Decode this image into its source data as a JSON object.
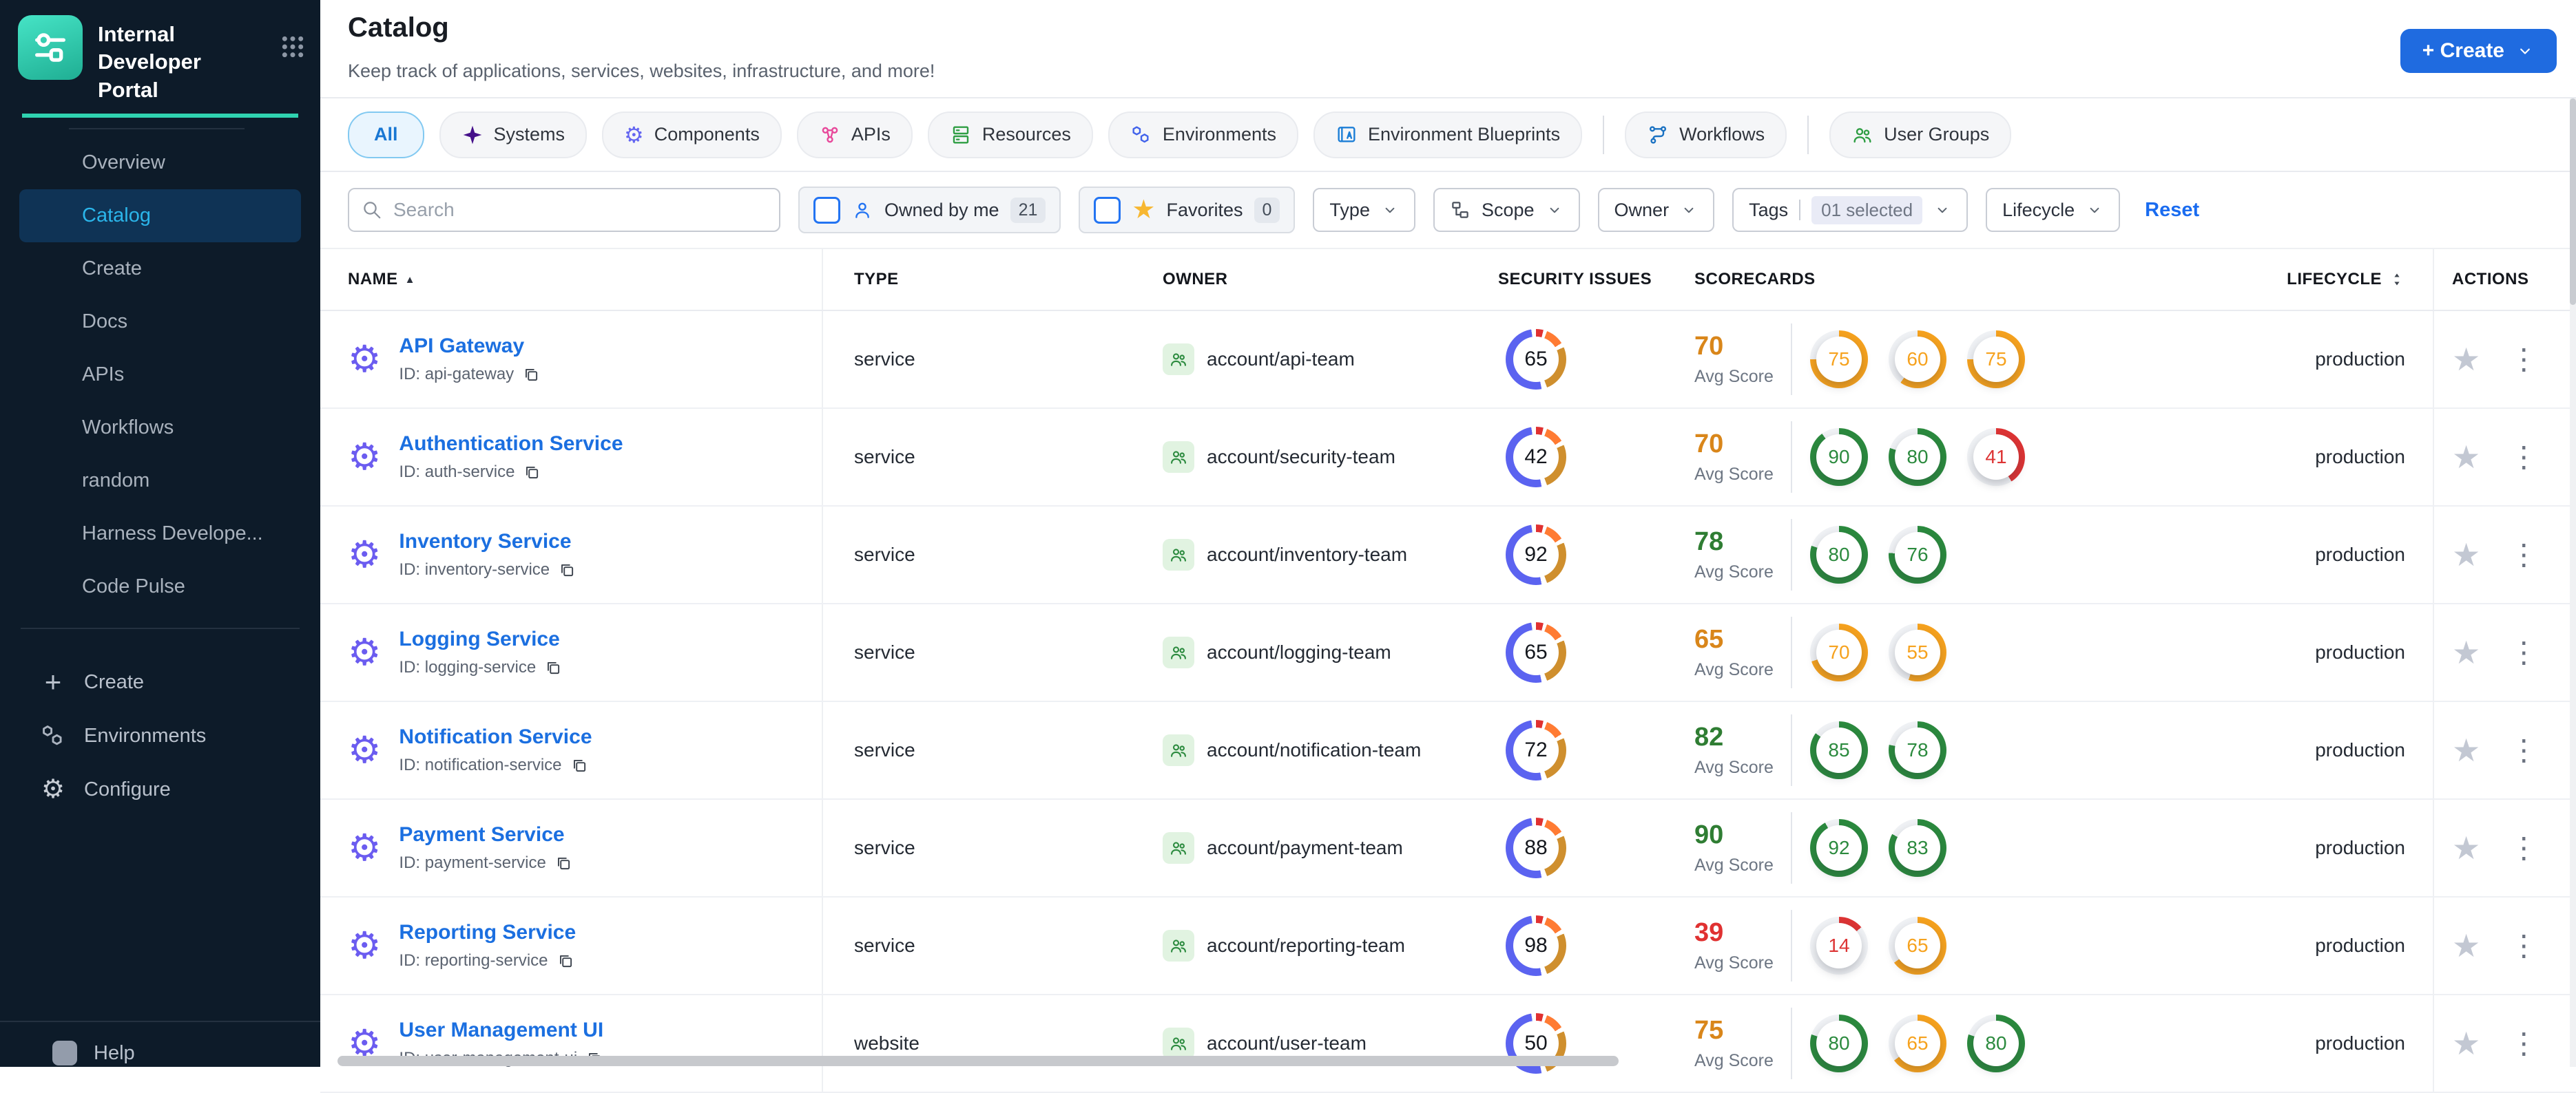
{
  "app": {
    "name": "Internal Developer Portal",
    "create_label": "+ Create",
    "accent_teal": "#2fd3b0",
    "primary_blue": "#1f6be0"
  },
  "icons": {
    "star": "★",
    "kebab": "⋮",
    "gear": "⚙",
    "sort_asc": "▲",
    "plus": "+"
  },
  "sidebar": {
    "items": [
      {
        "label": "Overview",
        "active": false
      },
      {
        "label": "Catalog",
        "active": true
      },
      {
        "label": "Create",
        "active": false
      },
      {
        "label": "Docs",
        "active": false
      },
      {
        "label": "APIs",
        "active": false
      },
      {
        "label": "Workflows",
        "active": false
      },
      {
        "label": "random",
        "active": false
      },
      {
        "label": "Harness Develope...",
        "active": false
      },
      {
        "label": "Code Pulse",
        "active": false
      }
    ],
    "bottom_items": [
      {
        "label": "Create",
        "icon": "plus"
      },
      {
        "label": "Environments",
        "icon": "hexagons"
      },
      {
        "label": "Configure",
        "icon": "gear"
      }
    ],
    "help_label": "Help"
  },
  "header": {
    "title": "Catalog",
    "subtitle": "Keep track of applications, services, websites, infrastructure, and more!"
  },
  "tabs": [
    {
      "label": "All",
      "active": true
    },
    {
      "label": "Systems",
      "icon": "star4",
      "icon_color": "#45108a"
    },
    {
      "label": "Components",
      "icon": "gearglyph",
      "icon_color": "#6466f1"
    },
    {
      "label": "APIs",
      "icon": "molecule",
      "icon_color": "#e8489a"
    },
    {
      "label": "Resources",
      "icon": "stack",
      "icon_color": "#2f9e44"
    },
    {
      "label": "Environments",
      "icon": "hexagons",
      "icon_color": "#4263eb"
    },
    {
      "label": "Environment Blueprints",
      "icon": "blueprint",
      "icon_color": "#1c7ed6"
    },
    {
      "divider": true
    },
    {
      "label": "Workflows",
      "icon": "flow",
      "icon_color": "#1971c2"
    },
    {
      "divider": true
    },
    {
      "label": "User Groups",
      "icon": "people",
      "icon_color": "#2f9e44"
    }
  ],
  "filters": {
    "search_placeholder": "Search",
    "owned_by_me": {
      "label": "Owned by me",
      "count": "21"
    },
    "favorites": {
      "label": "Favorites",
      "count": "0"
    },
    "dropdowns_left": [
      {
        "label": "Type"
      },
      {
        "label": "Scope",
        "icon": "hierarchy"
      },
      {
        "label": "Owner"
      }
    ],
    "tags": {
      "label": "Tags",
      "value": "01 selected"
    },
    "dropdowns_right": [
      {
        "label": "Lifecycle"
      }
    ],
    "reset_label": "Reset"
  },
  "table": {
    "headers": {
      "name": "NAME",
      "type": "TYPE",
      "owner": "OWNER",
      "security": "SECURITY ISSUES",
      "scorecards": "SCORECARDS",
      "lifecycle": "LIFECYCLE",
      "actions": "ACTIONS"
    },
    "avg_score_label": "Avg Score",
    "id_prefix": "ID: ",
    "rows": [
      {
        "name": "API Gateway",
        "id": "api-gateway",
        "type": "service",
        "owner": "account/api-team",
        "security_issues": 65,
        "avg_score": 70,
        "avg_color": "orange",
        "scores": [
          {
            "value": 75,
            "color": "orange"
          },
          {
            "value": 60,
            "color": "orange"
          },
          {
            "value": 75,
            "color": "orange"
          }
        ],
        "lifecycle": "production"
      },
      {
        "name": "Authentication Service",
        "id": "auth-service",
        "type": "service",
        "owner": "account/security-team",
        "security_issues": 42,
        "avg_score": 70,
        "avg_color": "orange",
        "scores": [
          {
            "value": 90,
            "color": "green"
          },
          {
            "value": 80,
            "color": "green"
          },
          {
            "value": 41,
            "color": "red"
          }
        ],
        "lifecycle": "production"
      },
      {
        "name": "Inventory Service",
        "id": "inventory-service",
        "type": "service",
        "owner": "account/inventory-team",
        "security_issues": 92,
        "avg_score": 78,
        "avg_color": "green",
        "scores": [
          {
            "value": 80,
            "color": "green"
          },
          {
            "value": 76,
            "color": "green"
          }
        ],
        "lifecycle": "production"
      },
      {
        "name": "Logging Service",
        "id": "logging-service",
        "type": "service",
        "owner": "account/logging-team",
        "security_issues": 65,
        "avg_score": 65,
        "avg_color": "orange",
        "scores": [
          {
            "value": 70,
            "color": "orange"
          },
          {
            "value": 55,
            "color": "orange"
          }
        ],
        "lifecycle": "production"
      },
      {
        "name": "Notification Service",
        "id": "notification-service",
        "type": "service",
        "owner": "account/notification-team",
        "security_issues": 72,
        "avg_score": 82,
        "avg_color": "green",
        "scores": [
          {
            "value": 85,
            "color": "green"
          },
          {
            "value": 78,
            "color": "green"
          }
        ],
        "lifecycle": "production"
      },
      {
        "name": "Payment Service",
        "id": "payment-service",
        "type": "service",
        "owner": "account/payment-team",
        "security_issues": 88,
        "avg_score": 90,
        "avg_color": "green",
        "scores": [
          {
            "value": 92,
            "color": "green"
          },
          {
            "value": 83,
            "color": "green"
          }
        ],
        "lifecycle": "production"
      },
      {
        "name": "Reporting Service",
        "id": "reporting-service",
        "type": "service",
        "owner": "account/reporting-team",
        "security_issues": 98,
        "avg_score": 39,
        "avg_color": "red",
        "scores": [
          {
            "value": 14,
            "color": "red"
          },
          {
            "value": 65,
            "color": "orange"
          }
        ],
        "lifecycle": "production"
      },
      {
        "name": "User Management UI",
        "id": "user-management-ui",
        "type": "website",
        "owner": "account/user-team",
        "security_issues": 50,
        "avg_score": 75,
        "avg_color": "orange",
        "scores": [
          {
            "value": 80,
            "color": "green"
          },
          {
            "value": 65,
            "color": "orange"
          },
          {
            "value": 80,
            "color": "green"
          }
        ],
        "lifecycle": "production"
      }
    ]
  },
  "colors": {
    "green": "#2b8a3e",
    "orange": "#f6a21e",
    "red": "#dd3434",
    "avg_green": "#2f7d33",
    "avg_orange": "#d9861a",
    "avg_red": "#e03131",
    "ring_rest": "#f0f2f5",
    "donut_segments": [
      "#e03131",
      "#ff7b33",
      "#cf8f2e",
      "#5b63f0"
    ]
  }
}
